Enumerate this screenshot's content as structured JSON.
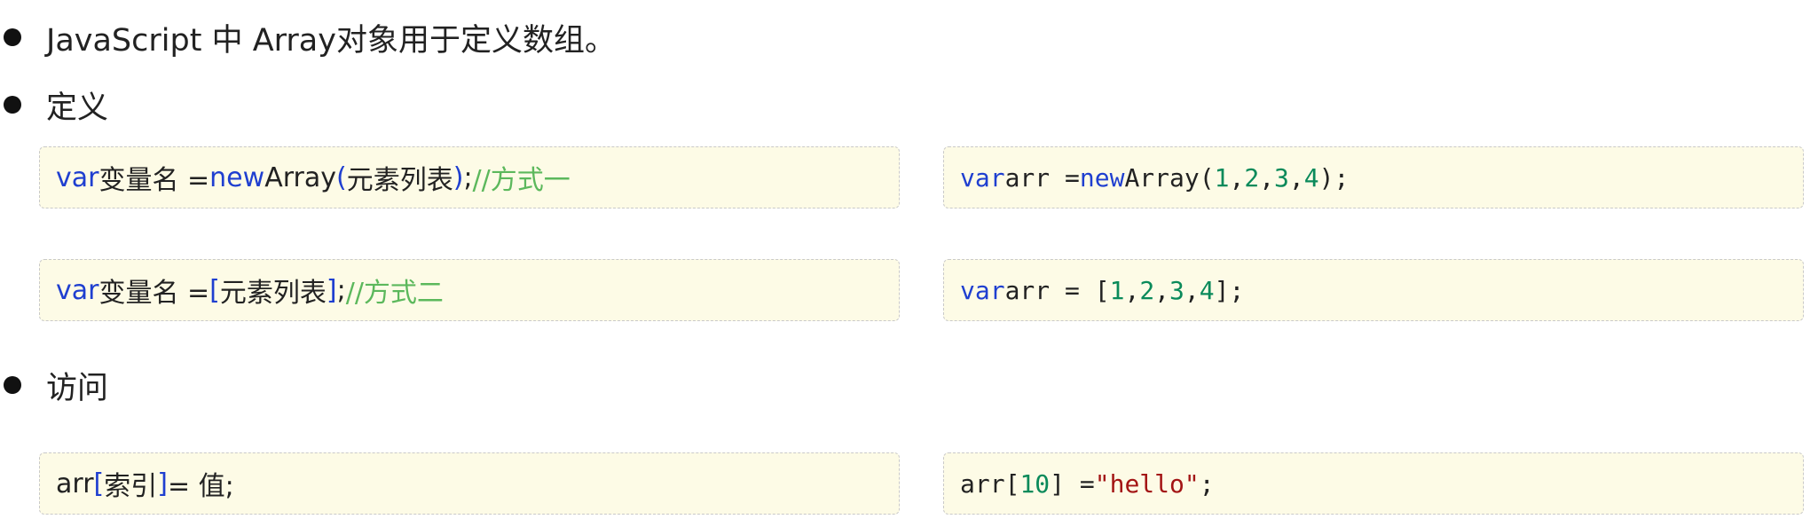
{
  "bullets": [
    {
      "text": "JavaScript 中 Array对象用于定义数组。"
    },
    {
      "text": "定义"
    },
    {
      "text": "访问"
    }
  ],
  "define": {
    "syntax1": {
      "kw_var": "var",
      "name": " 变量名 = ",
      "kw_new": "new",
      "array_open": " Array",
      "paren_open": "(",
      "elements": "元素列表",
      "paren_close": ")",
      "semicolon": "; ",
      "comment": "//方式一"
    },
    "example1": {
      "kw_var": "var",
      "arr_assign": " arr = ",
      "kw_new": "new",
      "array_open": " Array(",
      "n1": "1",
      "c1": ",",
      "n2": "2",
      "c2": ",",
      "n3": "3",
      "c3": ",",
      "n4": "4",
      "close": ");"
    },
    "syntax2": {
      "kw_var": "var",
      "name": " 变量名 = ",
      "bracket_open": "[",
      "elements": " 元素列表 ",
      "bracket_close": "]",
      "semicolon": "; ",
      "comment": "//方式二"
    },
    "example2": {
      "kw_var": "var",
      "arr_assign": " arr = [",
      "n1": "1",
      "c1": ",",
      "n2": "2",
      "c2": ",",
      "n3": "3",
      "c3": ",",
      "n4": "4",
      "close": "];"
    }
  },
  "access": {
    "syntax": {
      "arr": "arr",
      "bracket_open": "[",
      "index": " 索引 ",
      "bracket_close": "]",
      "assign": " = 值;"
    },
    "example": {
      "arr_open": "arr[",
      "index": "10",
      "assign": "] = ",
      "value": "\"hello\"",
      "semicolon": ";"
    }
  },
  "colors": {
    "keyword": "#1f3fd0",
    "comment": "#5cb85c",
    "number": "#0a8a5a",
    "string": "#a31515",
    "code_background": "#fdfbe6"
  }
}
